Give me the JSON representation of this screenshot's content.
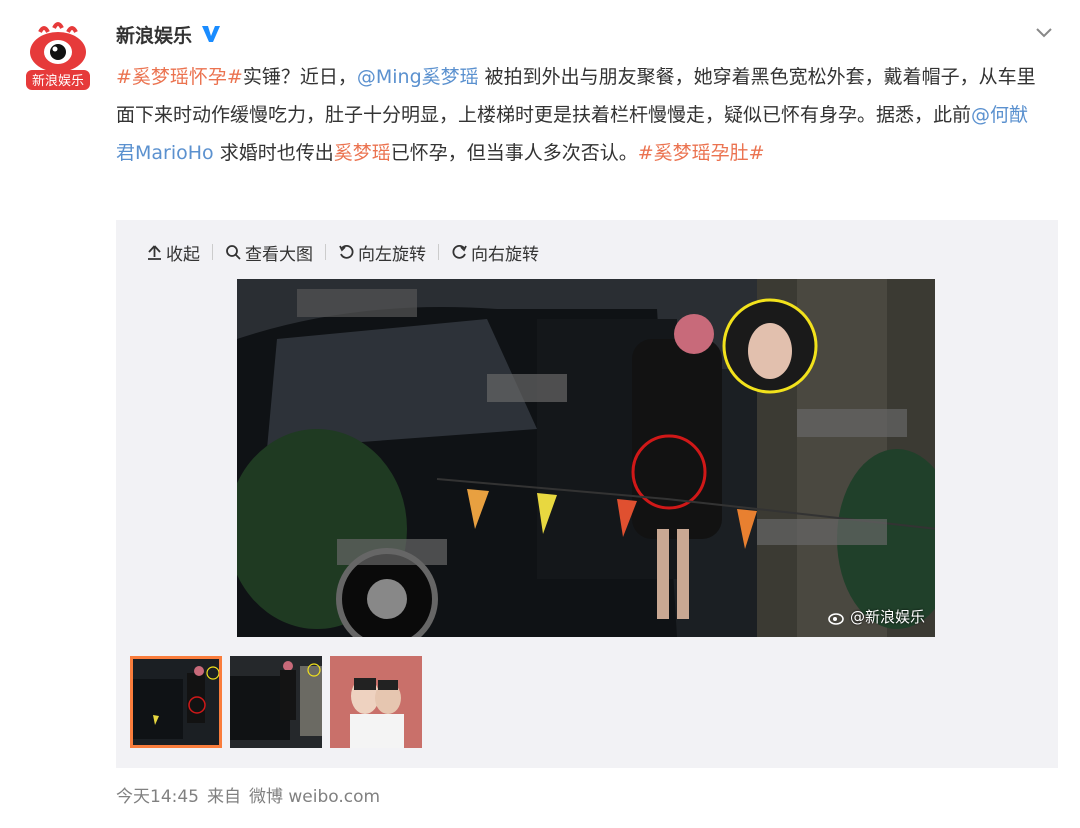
{
  "post": {
    "author": "新浪娱乐",
    "verified": true,
    "text_parts": [
      {
        "kind": "tag",
        "text": "#奚梦瑶怀孕#"
      },
      {
        "kind": "text",
        "text": "实锤？近日，"
      },
      {
        "kind": "mention",
        "text": "@Ming奚梦瑶"
      },
      {
        "kind": "text",
        "text": " 被拍到外出与朋友聚餐，她穿着黑色宽松外套，戴着帽子，从车里面下来时动作缓慢吃力，肚子十分明显，上楼梯时更是扶着栏杆慢慢走，疑似已怀有身孕。据悉，此前"
      },
      {
        "kind": "mention",
        "text": "@何猷君MarioHo"
      },
      {
        "kind": "text",
        "text": " 求婚时也传出"
      },
      {
        "kind": "name",
        "text": "奚梦瑶"
      },
      {
        "kind": "text",
        "text": "已怀孕，但当事人多次否认。"
      },
      {
        "kind": "tag",
        "text": "#奚梦瑶孕肚#"
      }
    ]
  },
  "toolbar": {
    "collapse": "收起",
    "view_large": "查看大图",
    "rotate_left": "向左旋转",
    "rotate_right": "向右旋转"
  },
  "watermark": "@新浪娱乐",
  "avatar_text": "新浪娱乐",
  "meta": {
    "time": "今天14:45",
    "source_prefix": "来自",
    "source": "微博 weibo.com"
  },
  "colors": {
    "tag": "#eb7350",
    "mention": "#5b91cf",
    "active_thumb": "#fa7d3c",
    "verified": "#1a8cff"
  }
}
